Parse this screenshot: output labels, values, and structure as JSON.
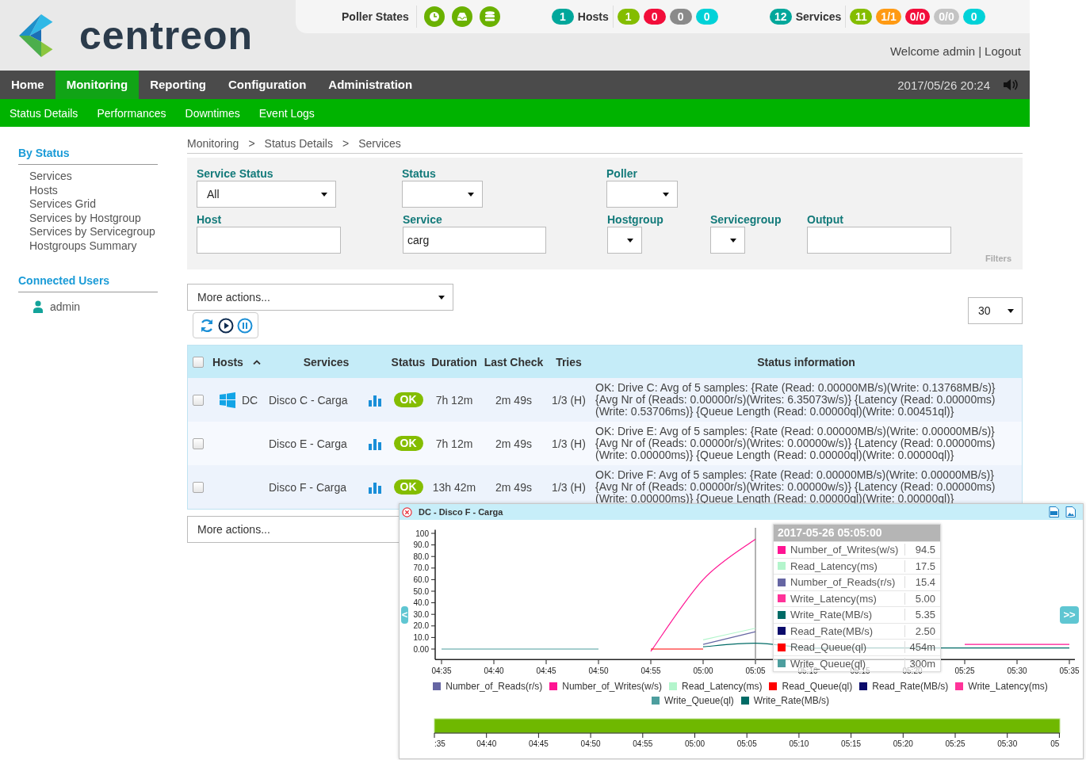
{
  "header": {
    "logo": "centreon",
    "poller_states": {
      "label": "Poller States"
    },
    "hosts": {
      "total": {
        "text": "1",
        "color": "#00a79b"
      },
      "label": "Hosts",
      "counts": [
        {
          "text": "1",
          "color": "#84bd00"
        },
        {
          "text": "0",
          "color": "#f20d3a"
        },
        {
          "text": "0",
          "color": "#8a8a8a"
        },
        {
          "text": "0",
          "color": "#00d2d8"
        }
      ]
    },
    "services": {
      "total": {
        "text": "12",
        "color": "#00a79b"
      },
      "label": "Services",
      "counts": [
        {
          "text": "11",
          "color": "#84bd00"
        },
        {
          "text": "1/1",
          "color": "#ff9a13"
        },
        {
          "text": "0/0",
          "color": "#f20d3a"
        },
        {
          "text": "0/0",
          "color": "#c4c4c4"
        },
        {
          "text": "0",
          "color": "#00d2d8"
        }
      ]
    },
    "welcome": "Welcome admin",
    "separator": "|",
    "logout": "Logout"
  },
  "nav": {
    "items": [
      {
        "label": "Home",
        "selected": false
      },
      {
        "label": "Monitoring",
        "selected": true
      },
      {
        "label": "Reporting",
        "selected": false
      },
      {
        "label": "Configuration",
        "selected": false
      },
      {
        "label": "Administration",
        "selected": false
      }
    ],
    "datetime": "2017/05/26 20:24"
  },
  "subnav": [
    "Status Details",
    "Performances",
    "Downtimes",
    "Event Logs"
  ],
  "sidebar": {
    "by_status": {
      "title": "By Status",
      "items": [
        "Services",
        "Hosts",
        "Services Grid",
        "Services by Hostgroup",
        "Services by Servicegroup",
        "Hostgroups Summary"
      ]
    },
    "connected_users": {
      "title": "Connected Users",
      "users": [
        "admin"
      ]
    }
  },
  "breadcrumb": {
    "items": [
      "Monitoring",
      "Status Details",
      "Services"
    ],
    "separator": ">"
  },
  "filters": {
    "rows": [
      [
        {
          "label": "Service Status",
          "kind": "select",
          "value": "All"
        },
        {
          "label": "Status",
          "kind": "select"
        },
        {
          "label": "Poller",
          "kind": "select"
        }
      ],
      [
        {
          "label": "Host",
          "kind": "input"
        },
        {
          "label": "Service",
          "kind": "input",
          "value": "carg"
        },
        {
          "label": "Hostgroup",
          "kind": "select"
        },
        {
          "label": "Servicegroup",
          "kind": "select"
        },
        {
          "label": "Output",
          "kind": "input"
        }
      ]
    ],
    "caption": "Filters"
  },
  "more_actions": "More actions...",
  "page_size": "30",
  "table": {
    "select_all": {
      "checked": false
    },
    "columns": [
      {
        "label": "Hosts",
        "sorted": true
      },
      {
        "label": "Services",
        "sorted": false
      },
      {
        "label": "Status",
        "sorted": false
      },
      {
        "label": "Duration",
        "sorted": false
      },
      {
        "label": "Last Check",
        "sorted": false
      },
      {
        "label": "Tries",
        "sorted": false
      },
      {
        "label": "Status information",
        "sorted": false
      }
    ],
    "rows": [
      {
        "checked": false,
        "host": "DC",
        "service": "Disco C - Carga",
        "status": "OK",
        "duration": "7h 12m",
        "last_check": "2m 49s",
        "tries": "1/3 (H)",
        "info": "OK: Drive C: Avg of 5 samples: {Rate (Read: 0.00000MB/s)(Write: 0.13768MB/s)} {Avg Nr of (Reads: 0.00000r/s)(Writes: 6.35073w/s)} {Latency (Read: 0.00000ms) (Write: 0.53706ms)} {Queue Length (Read: 0.00000ql)(Write: 0.00451ql)}"
      },
      {
        "checked": false,
        "service": "Disco E - Carga",
        "status": "OK",
        "duration": "7h 12m",
        "last_check": "2m 49s",
        "tries": "1/3 (H)",
        "info": "OK: Drive E: Avg of 5 samples: {Rate (Read: 0.00000MB/s)(Write: 0.00000MB/s)} {Avg Nr of (Reads: 0.00000r/s)(Writes: 0.00000w/s)} {Latency (Read: 0.00000ms) (Write: 0.00000ms)} {Queue Length (Read: 0.00000ql)(Write: 0.00000ql)}"
      },
      {
        "checked": false,
        "service": "Disco F - Carga",
        "status": "OK",
        "duration": "13h 42m",
        "last_check": "2m 49s",
        "tries": "1/3 (H)",
        "info": "OK: Drive F: Avg of 5 samples: {Rate (Read: 0.00000MB/s)(Write: 0.00000MB/s)} {Avg Nr of (Reads: 0.00000r/s)(Writes: 0.00000w/s)} {Latency (Read: 0.00000ms) (Write: 0.00000ms)} {Queue Length (Read: 0.00000ql)(Write: 0.00000ql)}"
      }
    ]
  },
  "bottom_more_actions": "More actions...",
  "popup": {
    "title": "DC - Disco F - Carga",
    "prev": "<",
    "next": ">>",
    "chart_data": {
      "type": "line",
      "categories": [
        "04:35",
        "04:40",
        "04:45",
        "04:50",
        "04:55",
        "05:00",
        "05:05",
        "05:10",
        "05:15",
        "05:20",
        "05:25",
        "05:30",
        "05:35"
      ],
      "ylim": [
        -9,
        103
      ],
      "yticks": [
        {
          "value": 0,
          "label": "0.00"
        },
        {
          "value": 10,
          "label": "10.0"
        },
        {
          "value": 20,
          "label": "20.0"
        },
        {
          "value": 30,
          "label": "30.0"
        },
        {
          "value": 40,
          "label": "40.0"
        },
        {
          "value": 50,
          "label": "50.0"
        },
        {
          "value": 60,
          "label": "60.0"
        },
        {
          "value": 70,
          "label": "70.0"
        },
        {
          "value": 80,
          "label": "80.0"
        },
        {
          "value": 90,
          "label": "90.0"
        },
        {
          "value": 100,
          "label": "100"
        }
      ],
      "series": [
        {
          "name": "Number_of_Reads(r/s)",
          "color": "#6666a3",
          "values": [
            null,
            null,
            null,
            null,
            null,
            4,
            15,
            null,
            null,
            null,
            null,
            null,
            null
          ]
        },
        {
          "name": "Number_of_Writes(w/s)",
          "color": "#ff1493",
          "values": [
            null,
            null,
            null,
            null,
            -2,
            60,
            95,
            null,
            null,
            null,
            4,
            4,
            4
          ]
        },
        {
          "name": "Read_Latency(ms)",
          "color": "#b3f5cc",
          "values": [
            null,
            null,
            null,
            null,
            null,
            8,
            18,
            null,
            null,
            null,
            null,
            null,
            null
          ]
        },
        {
          "name": "Read_Queue(ql)",
          "color": "#ff0000",
          "values": [
            null,
            null,
            null,
            null,
            0,
            0,
            null,
            null,
            null,
            null,
            null,
            null,
            null
          ]
        },
        {
          "name": "Read_Rate(MB/s)",
          "color": "#0b0b6b",
          "values": [
            null,
            null,
            null,
            null,
            null,
            null,
            null,
            null,
            null,
            null,
            null,
            null,
            null
          ]
        },
        {
          "name": "Write_Latency(ms)",
          "color": "#ff3399",
          "values": [
            null,
            null,
            null,
            null,
            null,
            null,
            null,
            null,
            null,
            null,
            null,
            null,
            null
          ]
        },
        {
          "name": "Write_Queue(ql)",
          "color": "#4d9e9e",
          "values": [
            0,
            0,
            0,
            0,
            null,
            null,
            null,
            null,
            null,
            null,
            null,
            null,
            null
          ]
        },
        {
          "name": "Write_Rate(MB/s)",
          "color": "#006b66",
          "values": [
            null,
            null,
            null,
            null,
            null,
            2,
            5,
            1,
            1,
            1,
            1,
            1,
            1
          ]
        }
      ]
    },
    "tooltip": {
      "title": "2017-05-26 05:05:00",
      "rows": [
        {
          "name": "Number_of_Writes(w/s)",
          "value": "94.5",
          "color": "#ff1493"
        },
        {
          "name": "Read_Latency(ms)",
          "value": "17.5",
          "color": "#b3f5cc"
        },
        {
          "name": "Number_of_Reads(r/s)",
          "value": "15.4",
          "color": "#6666a3"
        },
        {
          "name": "Write_Latency(ms)",
          "value": "5.00",
          "color": "#ff3399"
        },
        {
          "name": "Write_Rate(MB/s)",
          "value": "5.35",
          "color": "#006b66"
        },
        {
          "name": "Read_Rate(MB/s)",
          "value": "2.50",
          "color": "#0b0b6b"
        },
        {
          "name": "Read_Queue(ql)",
          "value": "454m",
          "color": "#ff0000"
        },
        {
          "name": "Write_Queue(ql)",
          "value": "300m",
          "color": "#4d9e9e"
        }
      ]
    },
    "navigator": {
      "ticks": [
        ":35",
        "04:40",
        "04:45",
        "04:50",
        "04:55",
        "05:00",
        "05:05",
        "05:10",
        "05:15",
        "05:20",
        "05:25",
        "05:30",
        "05"
      ]
    }
  }
}
